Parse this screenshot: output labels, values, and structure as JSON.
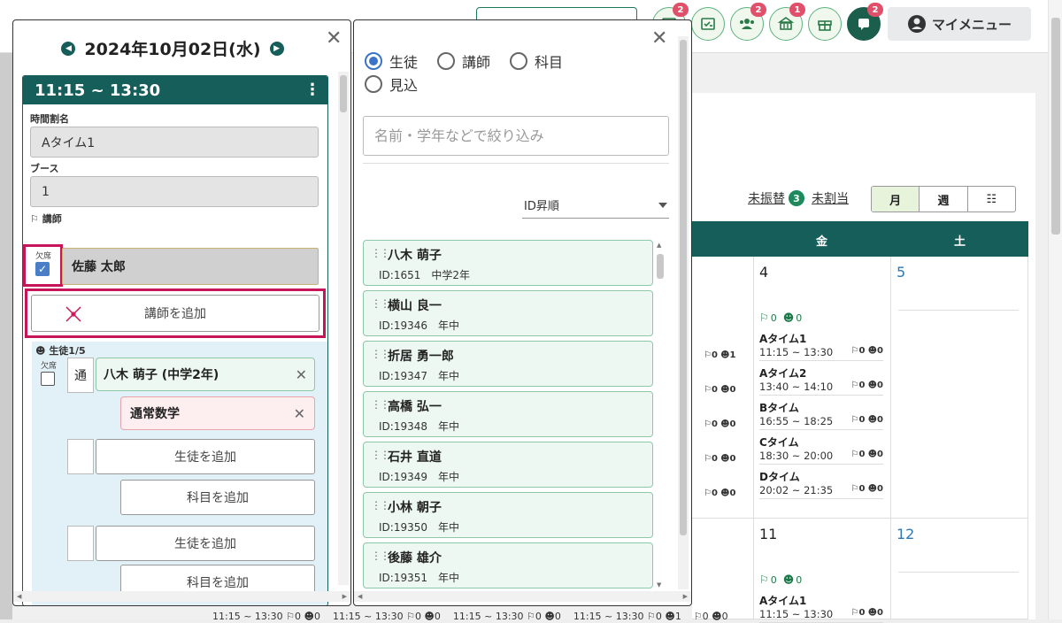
{
  "topbar": {
    "partial_button": "",
    "icons": [
      {
        "name": "calendar-icon",
        "badge": "2"
      },
      {
        "name": "report-icon",
        "badge": ""
      },
      {
        "name": "group-icon",
        "badge": "2"
      },
      {
        "name": "school-icon",
        "badge": "1"
      },
      {
        "name": "gift-icon",
        "badge": ""
      },
      {
        "name": "message-icon",
        "badge": "2"
      }
    ],
    "mymenu_label": "マイメニュー"
  },
  "calendar": {
    "links": {
      "unassigned_swap": "未振替",
      "unassigned_swap_count": "3",
      "unassigned": "未割当"
    },
    "views": [
      "月",
      "週",
      "☷"
    ],
    "active_view": "月",
    "headers": {
      "fri": "金",
      "sat": "土"
    },
    "week1": {
      "fri_day": "4",
      "sat_day": "5",
      "fri_counts": {
        "teachers": "0",
        "students": "0"
      },
      "slots": [
        {
          "name": "Aタイム1",
          "time": "11:15 ~ 13:30",
          "t": "0",
          "s": "0"
        },
        {
          "name": "Aタイム2",
          "time": "13:40 ~ 14:10",
          "t": "0",
          "s": "0"
        },
        {
          "name": "Bタイム",
          "time": "16:55 ~ 18:25",
          "t": "0",
          "s": "0"
        },
        {
          "name": "Cタイム",
          "time": "18:30 ~ 20:00",
          "t": "0",
          "s": "0"
        },
        {
          "name": "Dタイム",
          "time": "20:02 ~ 21:35",
          "t": "0",
          "s": "0"
        }
      ],
      "thu_counts": [
        {
          "t": "0",
          "s": "1"
        },
        {
          "t": "0",
          "s": "0"
        },
        {
          "t": "0",
          "s": "0"
        },
        {
          "t": "0",
          "s": "0"
        },
        {
          "t": "0",
          "s": "0"
        }
      ]
    },
    "week2": {
      "fri_day": "11",
      "sat_day": "12",
      "fri_counts": {
        "teachers": "0",
        "students": "0"
      },
      "slot": {
        "name": "Aタイム1",
        "time": "11:15 ~ 13:30",
        "t": "0",
        "s": "0"
      }
    },
    "bottom_times": [
      "11:15 ~ 13:30",
      "11:15 ~ 13:30",
      "11:15 ~ 13:30",
      "11:15 ~ 13:30"
    ],
    "bottom_counts": [
      "0",
      "0",
      "0",
      "0",
      "0",
      "0",
      "0",
      "1",
      "0",
      "0"
    ]
  },
  "lesson_dialog": {
    "date": "2024年10月02日(水)",
    "time_range": "11:15 ~ 13:30",
    "timetable_label": "時間割名",
    "timetable_value": "Aタイム1",
    "booth_label": "ブース",
    "booth_value": "1",
    "teacher_section": "講師",
    "absent_label": "欠席",
    "teacher_name": "佐藤 太郎",
    "add_teacher": "講師を追加",
    "student_section": "生徒1/5",
    "student_absent_label": "欠席",
    "student_type": "通",
    "student_name": "八木 萌子 (中学2年)",
    "subject_name": "通常数学",
    "add_student": "生徒を追加",
    "add_subject": "科目を追加"
  },
  "picker_dialog": {
    "radios": [
      {
        "label": "生徒",
        "checked": true
      },
      {
        "label": "講師",
        "checked": false
      },
      {
        "label": "科目",
        "checked": false
      },
      {
        "label": "見込",
        "checked": false
      }
    ],
    "search_placeholder": "名前・学年などで絞り込み",
    "sort_label": "ID昇順",
    "students": [
      {
        "name": "八木 萌子",
        "sub": "ID:1651　中学2年"
      },
      {
        "name": "横山 良一",
        "sub": "ID:19346　年中"
      },
      {
        "name": "折居 勇一郎",
        "sub": "ID:19347　年中"
      },
      {
        "name": "高橋 弘一",
        "sub": "ID:19348　年中"
      },
      {
        "name": "石井 直道",
        "sub": "ID:19349　年中"
      },
      {
        "name": "小林 朝子",
        "sub": "ID:19350　年中"
      },
      {
        "name": "後藤 雄介",
        "sub": "ID:19351　年中"
      }
    ]
  },
  "colors": {
    "primary": "#155e5a",
    "accent_red": "#c8155a",
    "student_bg": "#eef8f2",
    "subject_bg": "#fdeef0",
    "badge": "#e0506a"
  }
}
